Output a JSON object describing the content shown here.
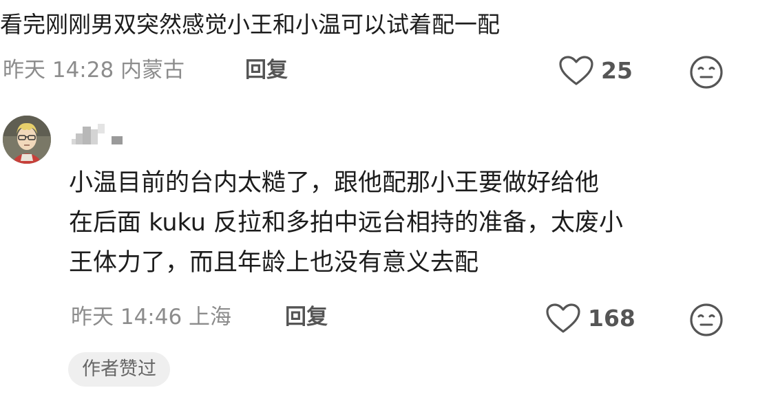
{
  "comment1": {
    "text": "看完刚刚男双突然感觉小王和小温可以试着配一配",
    "meta": "昨天 14:28 内蒙古",
    "reply_label": "回复",
    "like_count": "25"
  },
  "comment2": {
    "lines": [
      "小温目前的台内太糙了，跟他配那小王要做好给他",
      "在后面 kuku 反拉和多拍中远台相持的准备，太废小",
      "王体力了，而且年龄上也没有意义去配"
    ],
    "meta": "昨天 14:46 上海",
    "reply_label": "回复",
    "like_count": "168",
    "badge": "作者赞过"
  },
  "icons": {
    "like": "heart-outline-icon",
    "dislike": "neutral-face-icon"
  },
  "colors": {
    "text": "#1c1c1c",
    "meta": "#8c8c8c",
    "icon": "#555555",
    "badge_bg": "#efefef"
  }
}
